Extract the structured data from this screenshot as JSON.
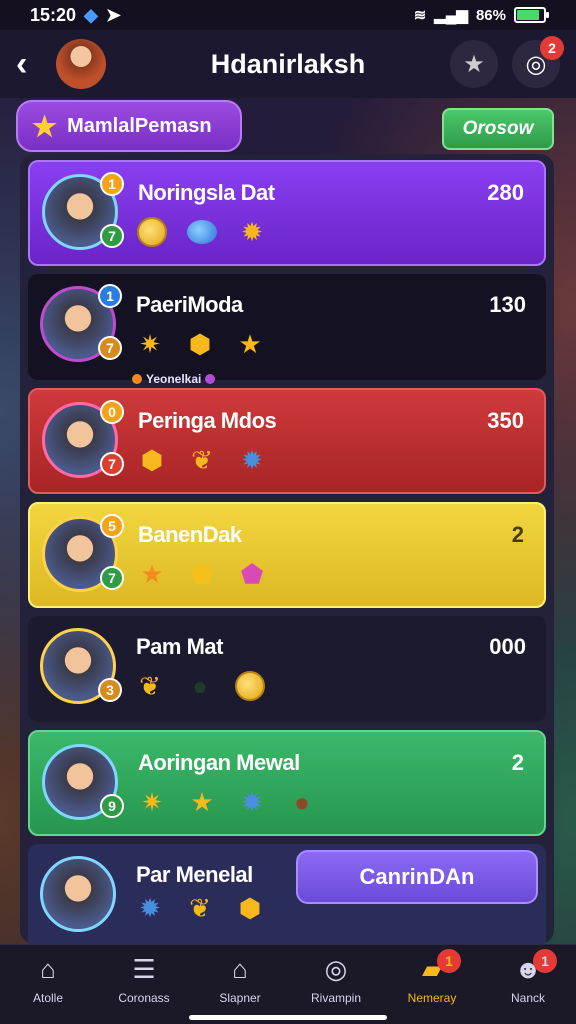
{
  "status_bar": {
    "time": "15:20",
    "battery": "86%"
  },
  "header": {
    "title": "Hdanirlaksh",
    "notif_count": "2"
  },
  "tag_pill": {
    "label": "MamlalPemasn"
  },
  "green_button": {
    "label": "Orosow"
  },
  "rows": [
    {
      "name": "Noringsla Dat",
      "score": "280",
      "badge_top": "1",
      "badge_bot": "7",
      "style": "purple",
      "items": [
        "coin",
        "gem",
        "gear"
      ]
    },
    {
      "name": "PaeriModa",
      "score": "130",
      "badge_top": "1",
      "badge_bot": "7",
      "style": "dark",
      "items": [
        "star-hex",
        "box",
        "star"
      ],
      "sub_label": "Yeonelkai"
    },
    {
      "name": "Peringa Mdos",
      "score": "350",
      "badge_top": "0",
      "badge_bot": "7",
      "style": "red",
      "items": [
        "hex",
        "leaf",
        "gear"
      ]
    },
    {
      "name": "BanenDak",
      "score": "2",
      "badge_top": "5",
      "badge_bot": "7",
      "style": "yellow",
      "items": [
        "star",
        "pentagon",
        "pentagon-pink"
      ]
    },
    {
      "name": "Pam Mat",
      "score": "000",
      "badge_top": "",
      "badge_bot": "3",
      "style": "navy",
      "items": [
        "leaf",
        "blank",
        "coin"
      ]
    },
    {
      "name": "Aoringan Mewal",
      "score": "2",
      "badge_top": "",
      "badge_bot": "9",
      "style": "green",
      "items": [
        "star-hex",
        "star",
        "gear",
        "bag"
      ]
    },
    {
      "name": "Par Menelal",
      "style": "darkblue",
      "badge_top": "",
      "badge_bot": "",
      "items": [
        "gear",
        "leaf",
        "hex"
      ]
    }
  ],
  "cta_button": {
    "label": "CanrinDAn"
  },
  "bottom_nav": [
    {
      "label": "Atolle",
      "icon": "home-icon"
    },
    {
      "label": "Coronass",
      "icon": "list-icon"
    },
    {
      "label": "Slapner",
      "icon": "camera-icon"
    },
    {
      "label": "Rivampin",
      "icon": "target-icon"
    },
    {
      "label": "Nemeray",
      "icon": "folder-icon",
      "active": true,
      "badge": "1"
    },
    {
      "label": "Nanck",
      "icon": "profile-icon",
      "badge": "1"
    }
  ]
}
